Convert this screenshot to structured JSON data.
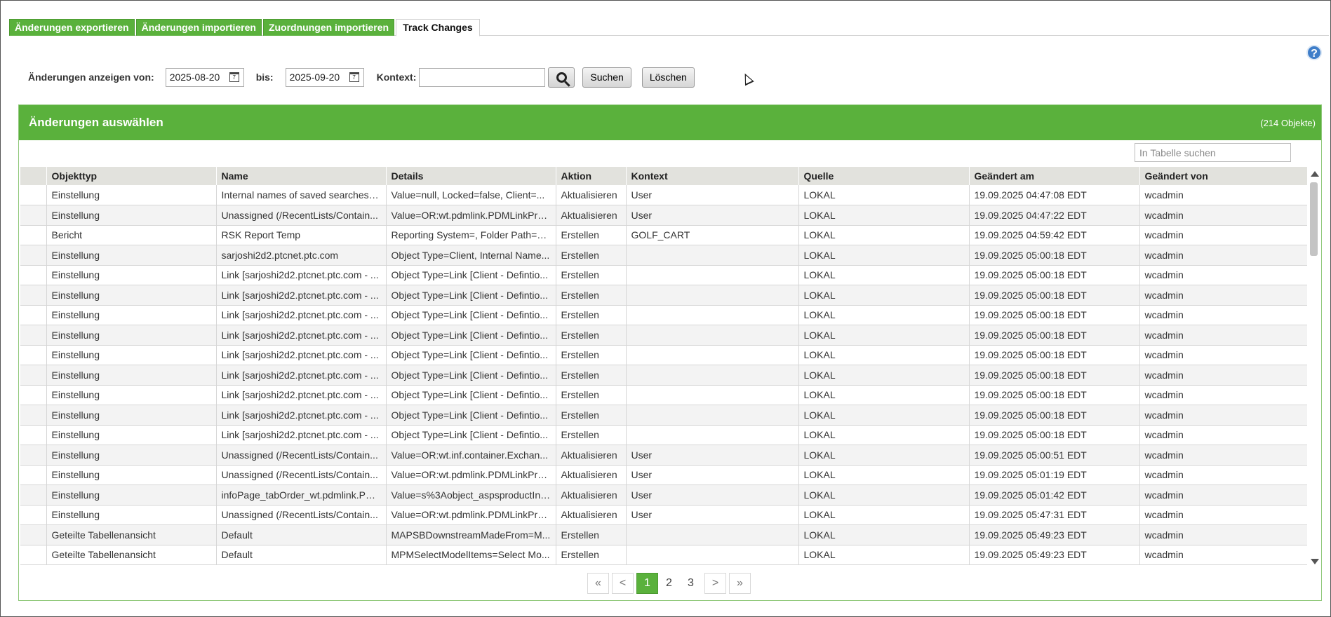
{
  "tabs": [
    {
      "label": "Änderungen exportieren",
      "active": false
    },
    {
      "label": "Änderungen importieren",
      "active": false
    },
    {
      "label": "Zuordnungen importieren",
      "active": false
    },
    {
      "label": "Track Changes",
      "active": true
    }
  ],
  "help_icon": {
    "glyph": "?",
    "icon": "help-icon"
  },
  "filter": {
    "from_label": "Änderungen anzeigen von:",
    "from_value": "2025-08-20",
    "to_label": "bis:",
    "to_value": "2025-09-20",
    "context_label": "Kontext:",
    "context_value": "",
    "search_label": "Suchen",
    "clear_label": "Löschen"
  },
  "panel": {
    "title": "Änderungen auswählen",
    "count": "(214 Objekte)",
    "table_search_placeholder": "In Tabelle suchen"
  },
  "table": {
    "columns": [
      "",
      "Objekttyp",
      "Name",
      "Details",
      "Aktion",
      "Kontext",
      "Quelle",
      "Geändert am",
      "Geändert von"
    ],
    "rows": [
      [
        "Einstellung",
        "Internal names of saved searches f...",
        "Value=null, Locked=false, Client=...",
        "Aktualisieren",
        "User",
        "LOKAL",
        "19.09.2025 04:47:08 EDT",
        "wcadmin"
      ],
      [
        "Einstellung",
        "Unassigned (/RecentLists/Contain...",
        "Value=OR:wt.pdmlink.PDMLinkPro...",
        "Aktualisieren",
        "User",
        "LOKAL",
        "19.09.2025 04:47:22 EDT",
        "wcadmin"
      ],
      [
        "Bericht",
        "RSK Report Temp",
        "Reporting System=, Folder Path=n...",
        "Erstellen",
        "GOLF_CART",
        "LOKAL",
        "19.09.2025 04:59:42 EDT",
        "wcadmin"
      ],
      [
        "Einstellung",
        "sarjoshi2d2.ptcnet.ptc.com",
        "Object Type=Client, Internal Name...",
        "Erstellen",
        "",
        "LOKAL",
        "19.09.2025 05:00:18 EDT",
        "wcadmin"
      ],
      [
        "Einstellung",
        "Link [sarjoshi2d2.ptcnet.ptc.com - ...",
        "Object Type=Link [Client - Defintio...",
        "Erstellen",
        "",
        "LOKAL",
        "19.09.2025 05:00:18 EDT",
        "wcadmin"
      ],
      [
        "Einstellung",
        "Link [sarjoshi2d2.ptcnet.ptc.com - ...",
        "Object Type=Link [Client - Defintio...",
        "Erstellen",
        "",
        "LOKAL",
        "19.09.2025 05:00:18 EDT",
        "wcadmin"
      ],
      [
        "Einstellung",
        "Link [sarjoshi2d2.ptcnet.ptc.com - ...",
        "Object Type=Link [Client - Defintio...",
        "Erstellen",
        "",
        "LOKAL",
        "19.09.2025 05:00:18 EDT",
        "wcadmin"
      ],
      [
        "Einstellung",
        "Link [sarjoshi2d2.ptcnet.ptc.com - ...",
        "Object Type=Link [Client - Defintio...",
        "Erstellen",
        "",
        "LOKAL",
        "19.09.2025 05:00:18 EDT",
        "wcadmin"
      ],
      [
        "Einstellung",
        "Link [sarjoshi2d2.ptcnet.ptc.com - ...",
        "Object Type=Link [Client - Defintio...",
        "Erstellen",
        "",
        "LOKAL",
        "19.09.2025 05:00:18 EDT",
        "wcadmin"
      ],
      [
        "Einstellung",
        "Link [sarjoshi2d2.ptcnet.ptc.com - ...",
        "Object Type=Link [Client - Defintio...",
        "Erstellen",
        "",
        "LOKAL",
        "19.09.2025 05:00:18 EDT",
        "wcadmin"
      ],
      [
        "Einstellung",
        "Link [sarjoshi2d2.ptcnet.ptc.com - ...",
        "Object Type=Link [Client - Defintio...",
        "Erstellen",
        "",
        "LOKAL",
        "19.09.2025 05:00:18 EDT",
        "wcadmin"
      ],
      [
        "Einstellung",
        "Link [sarjoshi2d2.ptcnet.ptc.com - ...",
        "Object Type=Link [Client - Defintio...",
        "Erstellen",
        "",
        "LOKAL",
        "19.09.2025 05:00:18 EDT",
        "wcadmin"
      ],
      [
        "Einstellung",
        "Link [sarjoshi2d2.ptcnet.ptc.com - ...",
        "Object Type=Link [Client - Defintio...",
        "Erstellen",
        "",
        "LOKAL",
        "19.09.2025 05:00:18 EDT",
        "wcadmin"
      ],
      [
        "Einstellung",
        "Unassigned (/RecentLists/Contain...",
        "Value=OR:wt.inf.container.Exchan...",
        "Aktualisieren",
        "User",
        "LOKAL",
        "19.09.2025 05:00:51 EDT",
        "wcadmin"
      ],
      [
        "Einstellung",
        "Unassigned (/RecentLists/Contain...",
        "Value=OR:wt.pdmlink.PDMLinkPro...",
        "Aktualisieren",
        "User",
        "LOKAL",
        "19.09.2025 05:01:19 EDT",
        "wcadmin"
      ],
      [
        "Einstellung",
        "infoPage_tabOrder_wt.pdmlink.PD...",
        "Value=s%3Aobject_aspsproductInf...",
        "Aktualisieren",
        "User",
        "LOKAL",
        "19.09.2025 05:01:42 EDT",
        "wcadmin"
      ],
      [
        "Einstellung",
        "Unassigned (/RecentLists/Contain...",
        "Value=OR:wt.pdmlink.PDMLinkPro...",
        "Aktualisieren",
        "User",
        "LOKAL",
        "19.09.2025 05:47:31 EDT",
        "wcadmin"
      ],
      [
        "Geteilte Tabellenansicht",
        "Default",
        "MAPSBDownstreamMadeFrom=M...",
        "Erstellen",
        "",
        "LOKAL",
        "19.09.2025 05:49:23 EDT",
        "wcadmin"
      ],
      [
        "Geteilte Tabellenansicht",
        "Default",
        "MPMSelectModelItems=Select Mo...",
        "Erstellen",
        "",
        "LOKAL",
        "19.09.2025 05:49:23 EDT",
        "wcadmin"
      ]
    ]
  },
  "pagination": {
    "first": "«",
    "prev": "<",
    "pages": [
      "1",
      "2",
      "3"
    ],
    "current": "1",
    "next": ">",
    "last": "»"
  },
  "colors": {
    "accent": "#5ab13c",
    "header_bg": "#e2e2dd"
  }
}
